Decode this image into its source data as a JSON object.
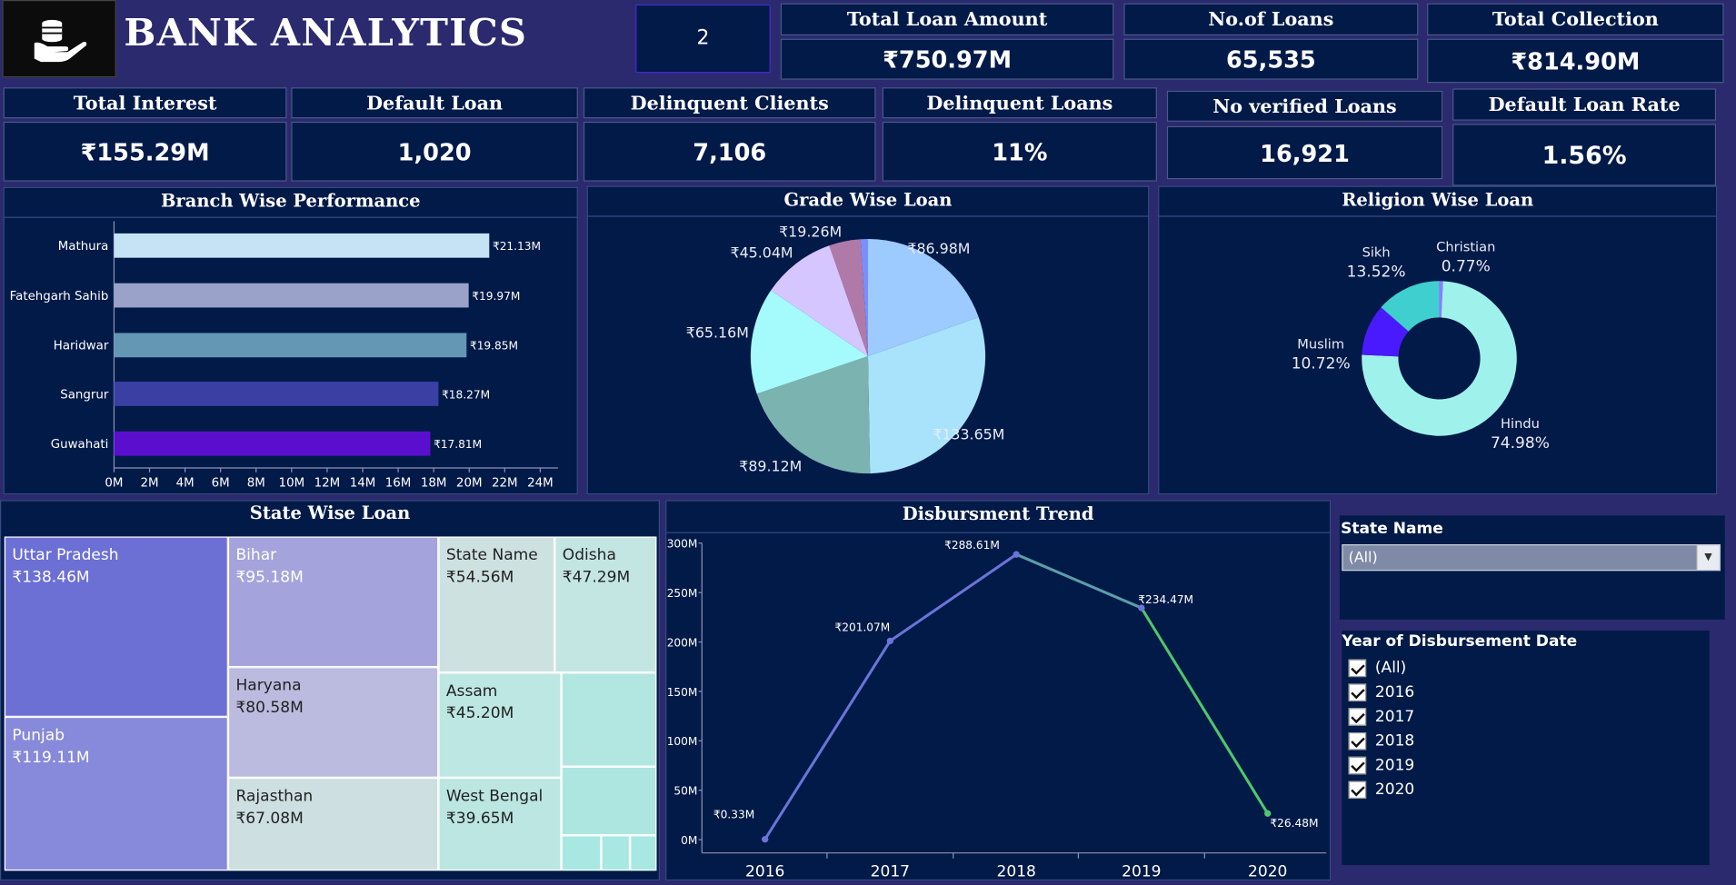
{
  "header": {
    "title": "BANK ANALYTICS",
    "counter": "2"
  },
  "kpis_top": [
    {
      "title": "Total Loan Amount",
      "value": "₹750.97M"
    },
    {
      "title": "No.of Loans",
      "value": "65,535"
    },
    {
      "title": "Total Collection",
      "value": "₹814.90M"
    }
  ],
  "kpis_row2": [
    {
      "title": "Total Interest",
      "value": "₹155.29M"
    },
    {
      "title": "Default Loan",
      "value": "1,020"
    },
    {
      "title": "Delinquent Clients",
      "value": "7,106"
    },
    {
      "title": "Delinquent Loans",
      "value": "11%"
    },
    {
      "title": "No verified Loans",
      "value": "16,921"
    },
    {
      "title": "Default Loan Rate",
      "value": "1.56%"
    }
  ],
  "titles": {
    "branch": "Branch Wise Performance",
    "grade": "Grade Wise Loan",
    "religion": "Religion Wise Loan",
    "state": "State Wise Loan",
    "trend": "Disbursment Trend"
  },
  "colors": {
    "background": "#2b2a6e",
    "panel": "#021a48",
    "line_blue": "#6b74d8",
    "line_green": "#4fc86a"
  },
  "chart_data": [
    {
      "type": "bar",
      "orientation": "horizontal",
      "categories": [
        "Mathura",
        "Fatehgarh Sahib",
        "Haridwar",
        "Sangrur",
        "Guwahati"
      ],
      "values": [
        21.13,
        19.97,
        19.85,
        18.27,
        17.81
      ],
      "labels": [
        "₹21.13M",
        "₹19.97M",
        "₹19.85M",
        "₹18.27M",
        "₹17.81M"
      ],
      "colors": [
        "#c6e2f5",
        "#9aa2c9",
        "#6497b4",
        "#3a3fa3",
        "#5a0fcf"
      ],
      "xticks": [
        "0M",
        "2M",
        "4M",
        "6M",
        "8M",
        "10M",
        "12M",
        "14M",
        "16M",
        "18M",
        "20M",
        "22M",
        "24M"
      ],
      "xlim": [
        0,
        25
      ],
      "grid": false
    },
    {
      "type": "pie",
      "values": [
        86.98,
        133.65,
        89.12,
        65.16,
        45.04,
        19.26,
        4.5
      ],
      "labels": [
        "₹86.98M",
        "₹133.65M",
        "₹89.12M",
        "₹65.16M",
        "₹45.04M",
        "₹19.26M",
        ""
      ],
      "colors": [
        "#9dcaff",
        "#a8e3fb",
        "#7ab3b0",
        "#a5fbfb",
        "#d6c6ff",
        "#b07aa8",
        "#7b8ffa"
      ]
    },
    {
      "type": "pie",
      "donut": true,
      "categories": [
        "Hindu",
        "Muslim",
        "Sikh",
        "Christian"
      ],
      "values": [
        74.98,
        10.72,
        13.52,
        0.77
      ],
      "labels": [
        "74.98%",
        "10.72%",
        "13.52%",
        "0.77%"
      ],
      "colors": [
        "#9ff2ec",
        "#4a1aff",
        "#3fcfcf",
        "#8f7cff"
      ]
    },
    {
      "type": "treemap",
      "cells": [
        {
          "name": "Uttar Pradesh",
          "value": "₹138.46M"
        },
        {
          "name": "Punjab",
          "value": "₹119.11M"
        },
        {
          "name": "Bihar",
          "value": "₹95.18M"
        },
        {
          "name": "Haryana",
          "value": "₹80.58M"
        },
        {
          "name": "Rajasthan",
          "value": "₹67.08M"
        },
        {
          "name": "State Name",
          "value": "₹54.56M"
        },
        {
          "name": "Odisha",
          "value": "₹47.29M"
        },
        {
          "name": "Assam",
          "value": "₹45.20M"
        },
        {
          "name": "West Bengal",
          "value": "₹39.65M"
        }
      ]
    },
    {
      "type": "line",
      "x": [
        "2016",
        "2017",
        "2018",
        "2019",
        "2020"
      ],
      "values": [
        0.33,
        201.07,
        288.61,
        234.47,
        26.48
      ],
      "labels": [
        "₹0.33M",
        "₹201.07M",
        "₹288.61M",
        "₹234.47M",
        "₹26.48M"
      ],
      "yticks": [
        "0M",
        "50M",
        "100M",
        "150M",
        "200M",
        "250M",
        "300M"
      ],
      "ylim": [
        0,
        300
      ],
      "grid": false
    }
  ],
  "filters": {
    "state_label": "State Name",
    "state_value": "(All)",
    "year_label": "Year of Disbursement Date",
    "year_options": [
      "(All)",
      "2016",
      "2017",
      "2018",
      "2019",
      "2020"
    ]
  }
}
